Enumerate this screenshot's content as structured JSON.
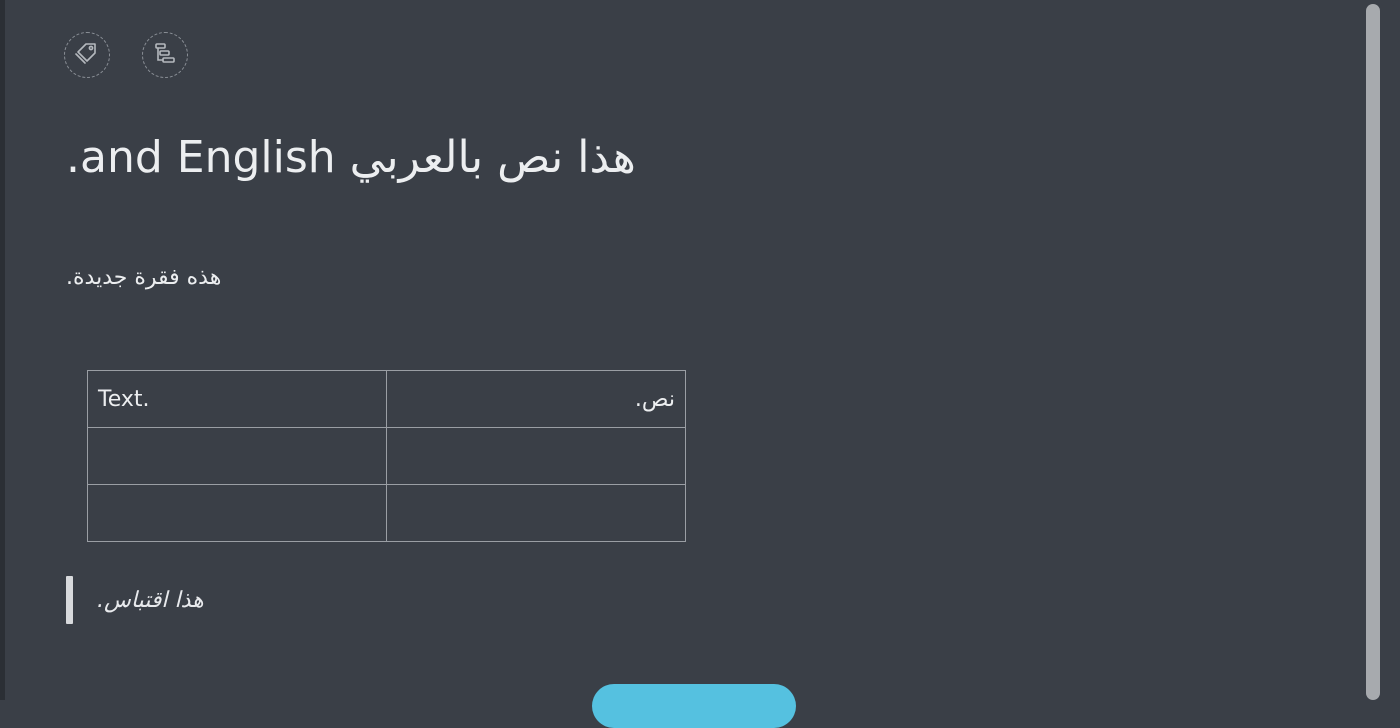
{
  "toolbar": {
    "tag_icon": "tag-icon",
    "outline_icon": "outline-icon"
  },
  "document": {
    "heading": "هذا نص بالعربي and English.",
    "paragraph": "هذه فقرة جديدة.",
    "table": {
      "rows": [
        [
          "Text.",
          "نص."
        ],
        [
          "",
          ""
        ],
        [
          "",
          ""
        ]
      ]
    },
    "blockquote": "هذا اقتباس."
  },
  "colors": {
    "background": "#3a3f47",
    "text": "#eceef0",
    "accent": "#55c1e0",
    "border": "#9a9ea4"
  }
}
